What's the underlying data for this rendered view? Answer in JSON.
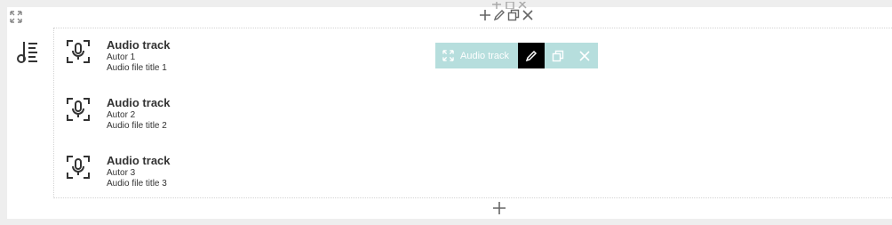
{
  "block": {
    "icons": {
      "expand": "expand-icon",
      "block_type": "audio-list-icon",
      "add": "plus-icon",
      "edit": "pencil-icon",
      "copy": "copy-icon",
      "remove": "close-icon",
      "track": "microphone-icon"
    },
    "tracks": [
      {
        "title": "Audio track",
        "author": "Autor 1",
        "file_title": "Audio file title 1"
      },
      {
        "title": "Audio track",
        "author": "Autor 2",
        "file_title": "Audio file title 2"
      },
      {
        "title": "Audio track",
        "author": "Autor 3",
        "file_title": "Audio file title 3"
      }
    ]
  },
  "floating_toolbar": {
    "label": "Audio track"
  },
  "colors": {
    "accent": "#b6dedd",
    "active": "#000000",
    "text": "#333333"
  }
}
